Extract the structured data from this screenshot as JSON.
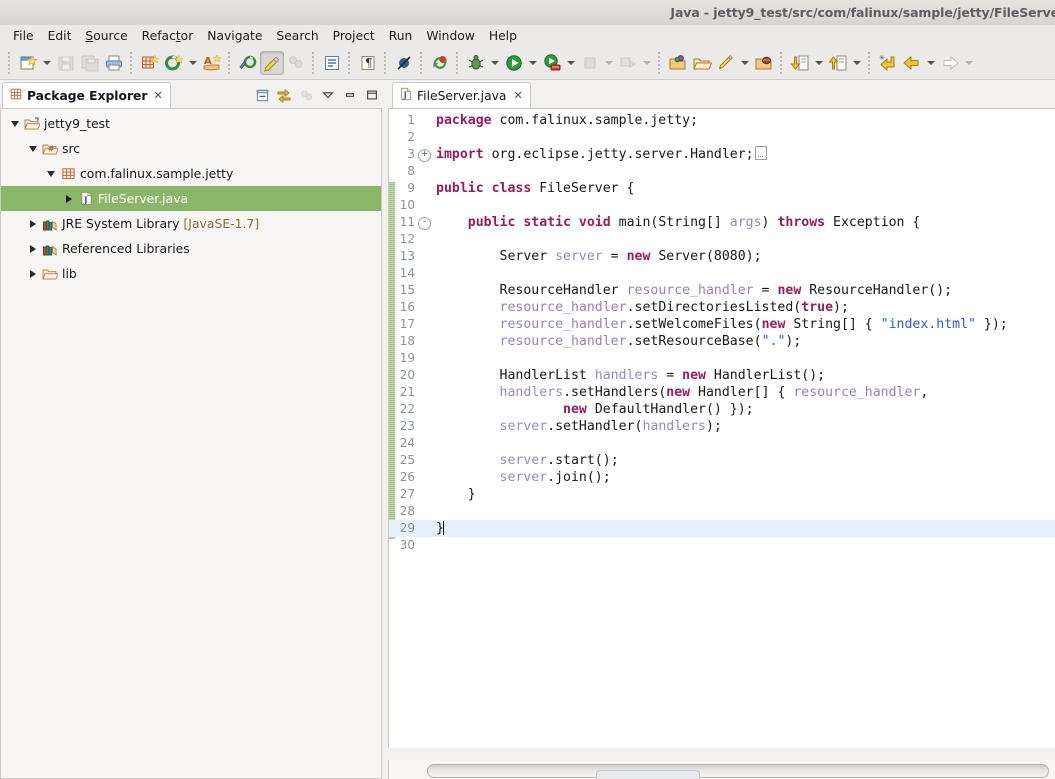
{
  "window": {
    "title": "Java - jetty9_test/src/com/falinux/sample/jetty/FileServe"
  },
  "menubar": {
    "items": [
      {
        "label": "File",
        "mnemonic_index": -1
      },
      {
        "label": "Edit",
        "mnemonic_index": -1
      },
      {
        "label": "Source",
        "mnemonic_index": 0
      },
      {
        "label": "Refactor",
        "mnemonic_index": 5
      },
      {
        "label": "Navigate",
        "mnemonic_index": -1
      },
      {
        "label": "Search",
        "mnemonic_index": -1
      },
      {
        "label": "Project",
        "mnemonic_index": -1
      },
      {
        "label": "Run",
        "mnemonic_index": -1
      },
      {
        "label": "Window",
        "mnemonic_index": -1
      },
      {
        "label": "Help",
        "mnemonic_index": -1
      }
    ]
  },
  "toolbar": {
    "groups": [
      {
        "buttons": [
          {
            "icon": "new-wizard-icon",
            "enabled": true,
            "dropdown": true
          },
          {
            "icon": "save-icon",
            "enabled": false,
            "dropdown": false
          },
          {
            "icon": "save-all-icon",
            "enabled": false,
            "dropdown": false
          },
          {
            "icon": "print-icon",
            "enabled": true,
            "dropdown": false
          }
        ]
      },
      {
        "buttons": [
          {
            "icon": "new-java-package-icon",
            "enabled": true,
            "dropdown": false
          },
          {
            "icon": "new-java-class-icon",
            "enabled": true,
            "dropdown": true
          },
          {
            "icon": "new-annotation-icon",
            "enabled": true,
            "dropdown": false
          }
        ]
      },
      {
        "buttons": [
          {
            "icon": "open-type-icon",
            "enabled": true,
            "dropdown": false
          },
          {
            "icon": "toggle-mark-occurrences-icon",
            "enabled": true,
            "pressed": true,
            "dropdown": false
          },
          {
            "icon": "build-all-icon",
            "enabled": false,
            "dropdown": false
          }
        ]
      },
      {
        "buttons": [
          {
            "icon": "show-whitespace-icon",
            "enabled": true,
            "dropdown": false
          },
          {
            "icon": "pilcrow-icon",
            "enabled": true,
            "dropdown": false
          }
        ]
      },
      {
        "buttons": [
          {
            "icon": "skip-breakpoints-icon",
            "enabled": true,
            "dropdown": false
          }
        ]
      },
      {
        "buttons": [
          {
            "icon": "refresh-icon",
            "enabled": true,
            "dropdown": false
          }
        ]
      },
      {
        "buttons": [
          {
            "icon": "debug-icon",
            "enabled": true,
            "dropdown": true
          },
          {
            "icon": "run-icon",
            "enabled": true,
            "dropdown": true
          },
          {
            "icon": "run-server-icon",
            "enabled": true,
            "dropdown": true
          },
          {
            "icon": "stop-icon",
            "enabled": false,
            "dropdown": true
          },
          {
            "icon": "publish-icon",
            "enabled": false,
            "dropdown": true
          }
        ]
      },
      {
        "buttons": [
          {
            "icon": "open-perspective-icon",
            "enabled": true,
            "dropdown": false
          },
          {
            "icon": "new-package-icon",
            "enabled": true,
            "dropdown": false
          },
          {
            "icon": "open-folder-icon",
            "enabled": true,
            "dropdown": false
          },
          {
            "icon": "pencil-icon",
            "enabled": true,
            "dropdown": true
          },
          {
            "icon": "archive-icon",
            "enabled": true,
            "dropdown": false
          }
        ]
      },
      {
        "buttons": [
          {
            "icon": "import-icon",
            "enabled": true,
            "dropdown": true
          },
          {
            "icon": "export-icon",
            "enabled": true,
            "dropdown": true
          }
        ]
      },
      {
        "buttons": [
          {
            "icon": "last-edit-location-icon",
            "enabled": true,
            "dropdown": false
          },
          {
            "icon": "back-icon",
            "enabled": true,
            "dropdown": true
          },
          {
            "icon": "forward-icon",
            "enabled": false,
            "dropdown": true
          }
        ]
      }
    ]
  },
  "package_explorer": {
    "tab_label": "Package Explorer",
    "tab_icon": "package-explorer-icon",
    "close_glyph": "✕",
    "toolbar": [
      {
        "icon": "collapse-all-icon",
        "enabled": true
      },
      {
        "icon": "link-with-editor-icon",
        "enabled": true
      },
      {
        "icon": "focus-on-active-task-icon",
        "enabled": false
      },
      {
        "icon": "view-menu-icon",
        "enabled": true
      },
      {
        "icon": "minimize-icon",
        "enabled": true
      },
      {
        "icon": "maximize-icon",
        "enabled": true
      }
    ],
    "tree": [
      {
        "label": "jetty9_test",
        "suffix": "",
        "indent": 0,
        "twisty": "down",
        "icon": "java-project-icon",
        "selected": false
      },
      {
        "label": "src",
        "suffix": "",
        "indent": 1,
        "twisty": "down",
        "icon": "source-folder-icon",
        "selected": false
      },
      {
        "label": "com.falinux.sample.jetty",
        "suffix": "",
        "indent": 2,
        "twisty": "down",
        "icon": "package-icon",
        "selected": false
      },
      {
        "label": "FileServer.java",
        "suffix": "",
        "indent": 3,
        "twisty": "right",
        "icon": "java-file-icon",
        "selected": true
      },
      {
        "label": "JRE System Library ",
        "suffix": "[JavaSE-1.7]",
        "indent": 1,
        "twisty": "right",
        "icon": "library-icon",
        "selected": false
      },
      {
        "label": "Referenced Libraries",
        "suffix": "",
        "indent": 1,
        "twisty": "right",
        "icon": "library-icon",
        "selected": false
      },
      {
        "label": "lib",
        "suffix": "",
        "indent": 1,
        "twisty": "right",
        "icon": "folder-icon",
        "selected": false
      }
    ]
  },
  "editor": {
    "tab_label": "FileServer.java",
    "tab_icon": "java-file-icon",
    "close_glyph": "✕",
    "current_line": 29,
    "lines": [
      {
        "n": 1,
        "fold": "",
        "tokens": [
          {
            "t": "kw",
            "v": "package"
          },
          {
            "t": "pln",
            "v": " com.falinux.sample.jetty;"
          }
        ]
      },
      {
        "n": 2,
        "fold": "",
        "tokens": []
      },
      {
        "n": 3,
        "fold": "+",
        "tokens": [
          {
            "t": "kw",
            "v": "import"
          },
          {
            "t": "pln",
            "v": " org.eclipse.jetty.server.Handler;"
          },
          {
            "t": "foldbox",
            "v": ""
          }
        ]
      },
      {
        "n": 8,
        "fold": "",
        "tokens": []
      },
      {
        "n": 9,
        "fold": "",
        "tokens": [
          {
            "t": "kw",
            "v": "public class"
          },
          {
            "t": "pln",
            "v": " FileServer {"
          }
        ]
      },
      {
        "n": 10,
        "fold": "",
        "tokens": []
      },
      {
        "n": 11,
        "fold": "-",
        "tokens": [
          {
            "t": "pln",
            "v": "    "
          },
          {
            "t": "kw",
            "v": "public static void"
          },
          {
            "t": "pln",
            "v": " main(String[] "
          },
          {
            "t": "var",
            "v": "args"
          },
          {
            "t": "pln",
            "v": ") "
          },
          {
            "t": "kw",
            "v": "throws"
          },
          {
            "t": "pln",
            "v": " Exception {"
          }
        ]
      },
      {
        "n": 12,
        "fold": "",
        "tokens": []
      },
      {
        "n": 13,
        "fold": "",
        "tokens": [
          {
            "t": "pln",
            "v": "        Server "
          },
          {
            "t": "var",
            "v": "server"
          },
          {
            "t": "pln",
            "v": " = "
          },
          {
            "t": "kw",
            "v": "new"
          },
          {
            "t": "pln",
            "v": " Server("
          },
          {
            "t": "num",
            "v": "8080"
          },
          {
            "t": "pln",
            "v": ");"
          }
        ]
      },
      {
        "n": 14,
        "fold": "",
        "tokens": []
      },
      {
        "n": 15,
        "fold": "",
        "tokens": [
          {
            "t": "pln",
            "v": "        ResourceHandler "
          },
          {
            "t": "fld",
            "v": "resource_handler"
          },
          {
            "t": "pln",
            "v": " = "
          },
          {
            "t": "kw",
            "v": "new"
          },
          {
            "t": "pln",
            "v": " ResourceHandler();"
          }
        ]
      },
      {
        "n": 16,
        "fold": "",
        "tokens": [
          {
            "t": "pln",
            "v": "        "
          },
          {
            "t": "fld",
            "v": "resource_handler"
          },
          {
            "t": "pln",
            "v": ".setDirectoriesListed("
          },
          {
            "t": "kw",
            "v": "true"
          },
          {
            "t": "pln",
            "v": ");"
          }
        ]
      },
      {
        "n": 17,
        "fold": "",
        "tokens": [
          {
            "t": "pln",
            "v": "        "
          },
          {
            "t": "fld",
            "v": "resource_handler"
          },
          {
            "t": "pln",
            "v": ".setWelcomeFiles("
          },
          {
            "t": "kw",
            "v": "new"
          },
          {
            "t": "pln",
            "v": " String[] { "
          },
          {
            "t": "str",
            "v": "\"index.html\""
          },
          {
            "t": "pln",
            "v": " });"
          }
        ]
      },
      {
        "n": 18,
        "fold": "",
        "tokens": [
          {
            "t": "pln",
            "v": "        "
          },
          {
            "t": "fld",
            "v": "resource_handler"
          },
          {
            "t": "pln",
            "v": ".setResourceBase("
          },
          {
            "t": "str",
            "v": "\".\""
          },
          {
            "t": "pln",
            "v": ");"
          }
        ]
      },
      {
        "n": 19,
        "fold": "",
        "tokens": []
      },
      {
        "n": 20,
        "fold": "",
        "tokens": [
          {
            "t": "pln",
            "v": "        HandlerList "
          },
          {
            "t": "var",
            "v": "handlers"
          },
          {
            "t": "pln",
            "v": " = "
          },
          {
            "t": "kw",
            "v": "new"
          },
          {
            "t": "pln",
            "v": " HandlerList();"
          }
        ]
      },
      {
        "n": 21,
        "fold": "",
        "tokens": [
          {
            "t": "pln",
            "v": "        "
          },
          {
            "t": "var",
            "v": "handlers"
          },
          {
            "t": "pln",
            "v": ".setHandlers("
          },
          {
            "t": "kw",
            "v": "new"
          },
          {
            "t": "pln",
            "v": " Handler[] { "
          },
          {
            "t": "fld",
            "v": "resource_handler"
          },
          {
            "t": "pln",
            "v": ","
          }
        ]
      },
      {
        "n": 22,
        "fold": "",
        "tokens": [
          {
            "t": "pln",
            "v": "                "
          },
          {
            "t": "kw",
            "v": "new"
          },
          {
            "t": "pln",
            "v": " DefaultHandler() });"
          }
        ]
      },
      {
        "n": 23,
        "fold": "",
        "tokens": [
          {
            "t": "pln",
            "v": "        "
          },
          {
            "t": "var",
            "v": "server"
          },
          {
            "t": "pln",
            "v": ".setHandler("
          },
          {
            "t": "var",
            "v": "handlers"
          },
          {
            "t": "pln",
            "v": ");"
          }
        ]
      },
      {
        "n": 24,
        "fold": "",
        "tokens": []
      },
      {
        "n": 25,
        "fold": "",
        "tokens": [
          {
            "t": "pln",
            "v": "        "
          },
          {
            "t": "var",
            "v": "server"
          },
          {
            "t": "pln",
            "v": ".start();"
          }
        ]
      },
      {
        "n": 26,
        "fold": "",
        "tokens": [
          {
            "t": "pln",
            "v": "        "
          },
          {
            "t": "var",
            "v": "server"
          },
          {
            "t": "pln",
            "v": ".join();"
          }
        ]
      },
      {
        "n": 27,
        "fold": "",
        "tokens": [
          {
            "t": "pln",
            "v": "    }"
          }
        ]
      },
      {
        "n": 28,
        "fold": "",
        "tokens": []
      },
      {
        "n": 29,
        "fold": "",
        "tokens": [
          {
            "t": "pln",
            "v": "}"
          },
          {
            "t": "caret",
            "v": ""
          }
        ]
      },
      {
        "n": 30,
        "fold": "",
        "tokens": []
      }
    ]
  },
  "colors": {
    "selection_green": "#89b767",
    "keyword": "#9b1b5b",
    "string": "#2a5fdb",
    "field": "#9a7fb8",
    "local_var": "#9a8bb4",
    "line_number": "#8c9396",
    "current_line_bg": "#e6f0fb",
    "change_bar": "#9fbf82",
    "chrome_bg": "#ebeae8",
    "library_suffix": "#8a6a36"
  }
}
